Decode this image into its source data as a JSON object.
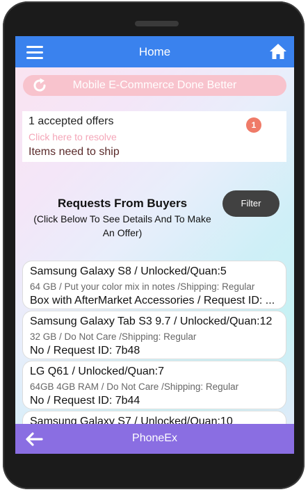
{
  "header": {
    "title": "Home",
    "menu_icon": "hamburger-menu-icon",
    "home_icon": "home-icon",
    "color": "#3a82ee"
  },
  "refresh_banner": {
    "text": "Mobile E-Commerce Done Better",
    "icon": "refresh-icon",
    "color": "#f8c3cd"
  },
  "offers": {
    "accepted": "1 accepted offers",
    "resolve_link": "Click here to resolve",
    "ship": "Items need to ship",
    "badge_count": "1"
  },
  "requests": {
    "title": "Requests From Buyers",
    "subtitle": "(Click Below To See Details And To Make An Offer)",
    "filter_label": "Filter"
  },
  "items": [
    {
      "line1": "Samsung Galaxy S8 / Unlocked/Quan:5",
      "line2": "64 GB / Put your color mix in notes /Shipping: Regular",
      "line3": "Box with AfterMarket Accessories / Request ID: ..."
    },
    {
      "line1": "Samsung Galaxy Tab S3 9.7 / Unlocked/Quan:12",
      "line2": "32 GB / Do Not Care /Shipping: Regular",
      "line3": "No / Request ID: 7b48"
    },
    {
      "line1": "LG Q61 / Unlocked/Quan:7",
      "line2": "64GB 4GB RAM / Do Not Care /Shipping: Regular",
      "line3": "No / Request ID: 7b44"
    },
    {
      "line1": "Samsung Galaxy S7 / Unlocked/Quan:10",
      "line2": "",
      "line3": ""
    }
  ],
  "footer": {
    "title": "PhoneEx",
    "back_icon": "back-arrow-icon",
    "color": "#8a6ee2"
  }
}
